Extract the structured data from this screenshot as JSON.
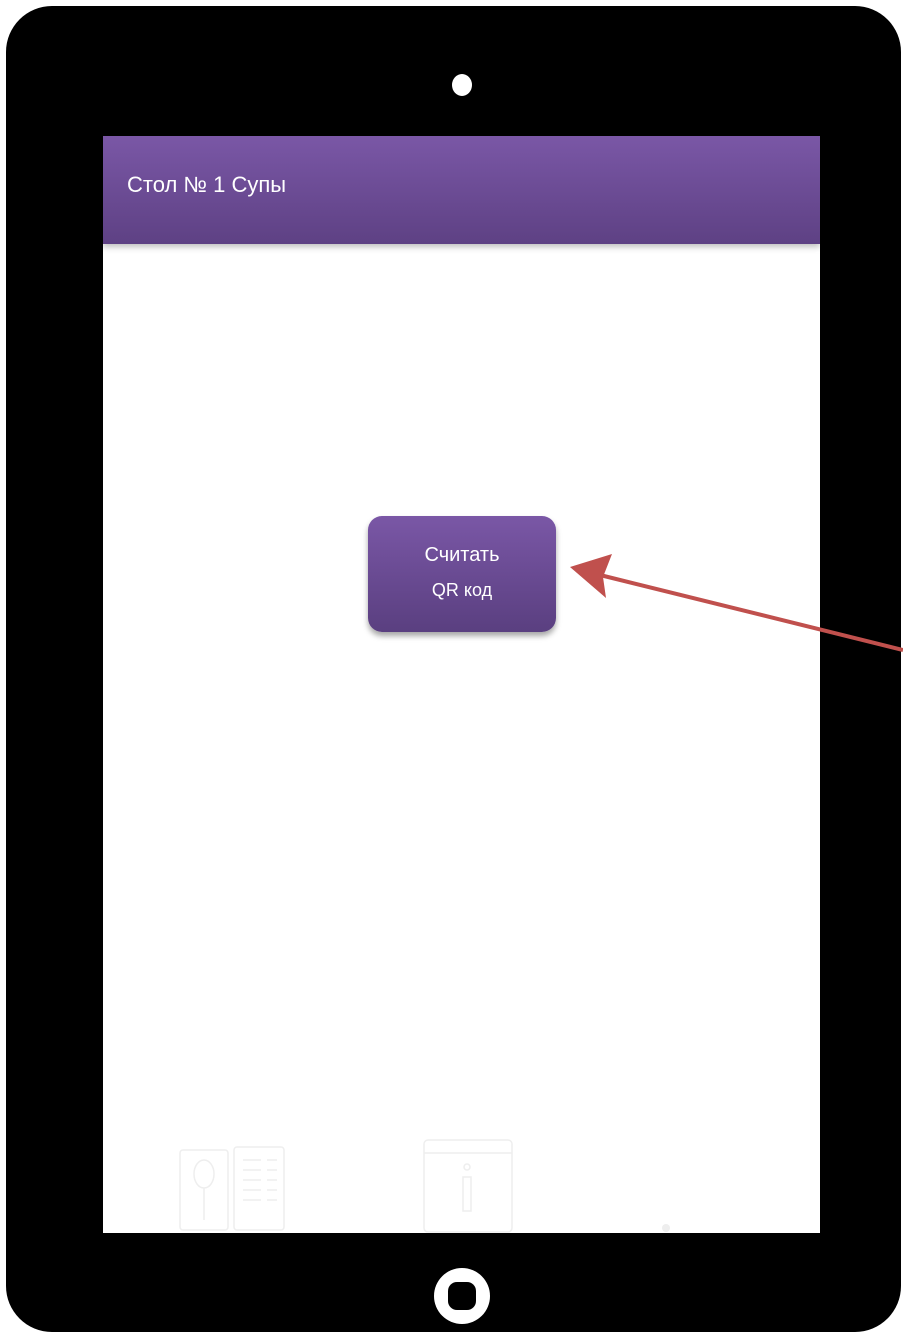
{
  "app_bar": {
    "title": "Стол № 1 Супы"
  },
  "scan_button": {
    "line1": "Считать",
    "line2": "QR код"
  },
  "bottom_nav": {
    "items": [
      {
        "icon": "menu-book-icon"
      },
      {
        "icon": "info-icon"
      },
      {
        "icon": "third-nav-icon"
      }
    ]
  },
  "colors": {
    "accent": "#7a57a6",
    "accent_dark": "#5e4184",
    "arrow": "#c0504d",
    "frame": "#000000"
  }
}
